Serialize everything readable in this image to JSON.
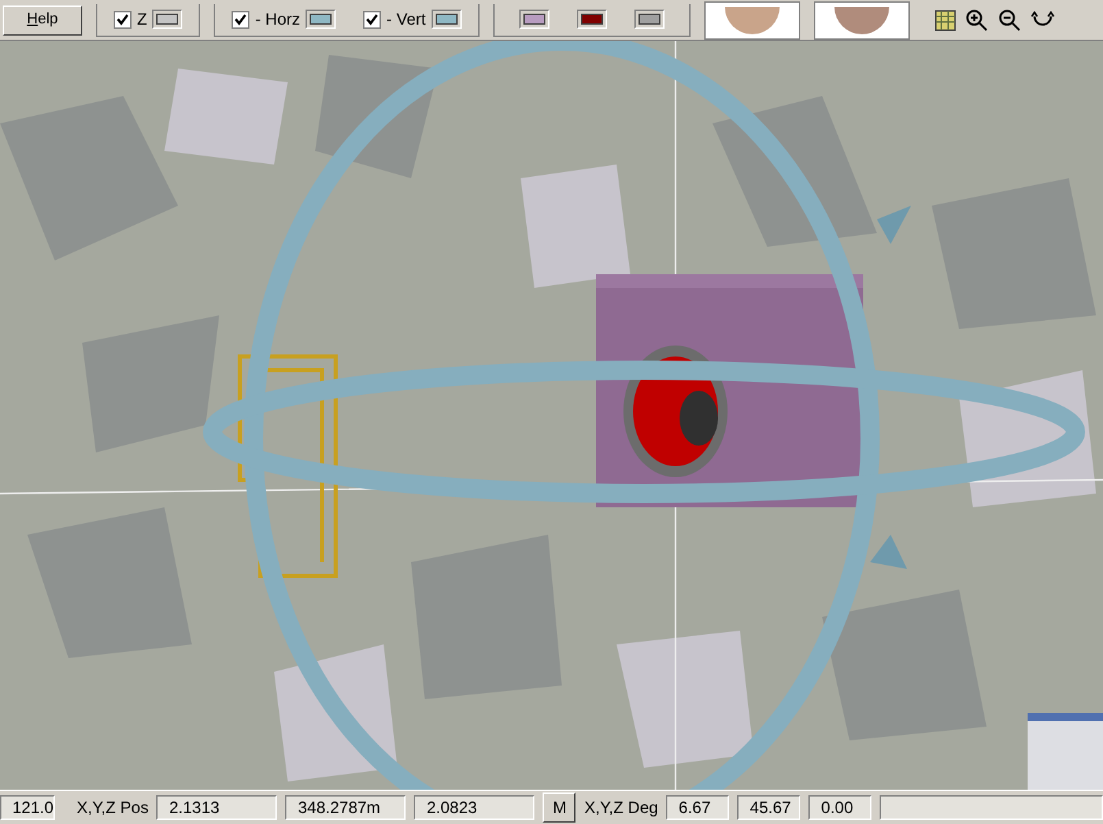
{
  "toolbar": {
    "help_button": "Help",
    "checkboxes": [
      {
        "label": "Z",
        "checked": true,
        "color": "#c4c4c4"
      },
      {
        "label": "- Horz",
        "checked": true,
        "color": "#8fb8c4"
      },
      {
        "label": "- Vert",
        "checked": true,
        "color": "#8fb8c4"
      }
    ],
    "swatches": [
      {
        "color": "#b89cc0"
      },
      {
        "color": "#800000"
      },
      {
        "color": "#a0a0a0"
      }
    ]
  },
  "status_bar": {
    "first_field": "121.0",
    "pos_label": "X,Y,Z Pos",
    "pos_values": [
      "2.1313",
      "348.2787m",
      "2.0823"
    ],
    "mode_button": "M",
    "deg_label": "X,Y,Z Deg",
    "deg_values": [
      "6.67",
      "45.67",
      "0.00"
    ]
  }
}
